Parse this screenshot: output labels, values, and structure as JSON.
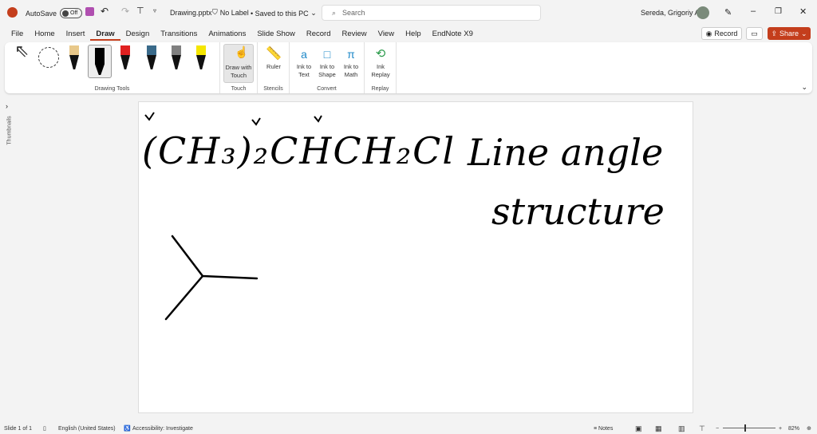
{
  "titlebar": {
    "autosave": "AutoSave",
    "autosave_state": "Off",
    "filename": "Drawing.pptx",
    "label": "No Label",
    "saved": "• Saved to this PC",
    "search_placeholder": "Search",
    "user": "Sereda, Grigoriy A"
  },
  "menu": {
    "tabs": [
      "File",
      "Home",
      "Insert",
      "Draw",
      "Design",
      "Transitions",
      "Animations",
      "Slide Show",
      "Record",
      "Review",
      "View",
      "Help",
      "EndNote X9"
    ],
    "active": "Draw",
    "record": "Record",
    "share": "Share"
  },
  "ribbon": {
    "drawing_tools": "Drawing Tools",
    "draw_with_touch": "Draw with Touch",
    "touch": "Touch",
    "ruler": "Ruler",
    "stencils": "Stencils",
    "ink_to_text": "Ink to Text",
    "ink_to_shape": "Ink to Shape",
    "ink_to_math": "Ink to Math",
    "convert": "Convert",
    "ink_replay": "Ink Replay",
    "replay": "Replay",
    "pen_colors": [
      "#e8c88a",
      "#000000",
      "#e02020",
      "#3a6a8a",
      "#808080",
      "#f5e600"
    ]
  },
  "sidebar": {
    "label": "Thumbnails"
  },
  "slide": {
    "formula": "(CH₃)₂CHCH₂Cl",
    "title_line1": "Line angle",
    "title_line2": "structure"
  },
  "status": {
    "slide": "Slide 1 of 1",
    "language": "English (United States)",
    "accessibility": "Accessibility: Investigate",
    "notes": "Notes",
    "zoom": "82%",
    "zoom_percent": 82
  },
  "colors": {
    "accent": "#c43e1c",
    "brand": "#c43e1c"
  }
}
